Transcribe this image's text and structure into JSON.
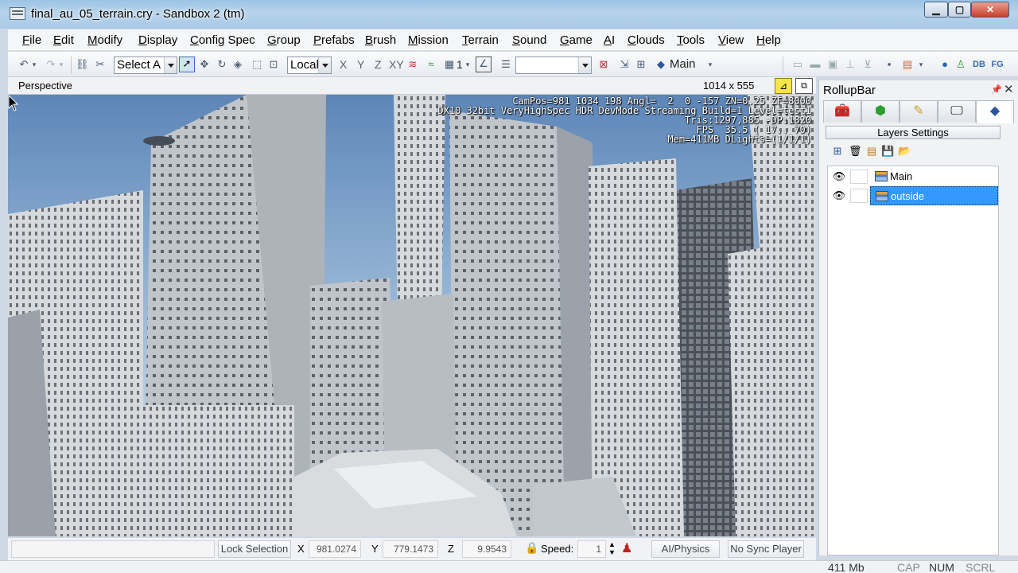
{
  "window": {
    "title": "final_au_05_terrain.cry - Sandbox 2 (tm)",
    "min_icon": "minimize-icon",
    "max_icon": "maximize-icon",
    "close_label": "✕"
  },
  "menu": [
    "File",
    "Edit",
    "Modify",
    "Display",
    "Config Spec",
    "Group",
    "Prefabs",
    "Brush",
    "Mission",
    "Terrain",
    "Sound",
    "Game",
    "AI",
    "Clouds",
    "Tools",
    "View",
    "Help"
  ],
  "toolbar": {
    "select_filter": "Select A",
    "coord_system": "Local",
    "axis_x": "X",
    "axis_y": "Y",
    "axis_z": "Z",
    "axis_xy": "XY",
    "grid_label": "1",
    "layer_label": "Main"
  },
  "viewport": {
    "title": "Perspective",
    "size": "1014 x 555",
    "hud_lines": [
      "CamPos=981 1034 198 Angl=  2  0 -157 ZN=0.25 ZF=8000",
      "DX10 32bit VeryHighSpec HDR DevMode Streaming Build=1 Level=test1",
      "Tris:1297,885 -DP:1820",
      "FPS  35.5 ( 17.. 70)",
      "Mem=411MB DLights=(1/1/1)"
    ]
  },
  "rollup": {
    "title": "RollupBar",
    "tabs": [
      "objects-tab-icon",
      "terrain-tab-icon",
      "modify-tab-icon",
      "display-tab-icon",
      "layers-tab-icon"
    ],
    "section_header": "Layers Settings",
    "layers": [
      {
        "name": "Main",
        "selected": false
      },
      {
        "name": "outside",
        "selected": true
      }
    ]
  },
  "infobar": {
    "lock_selection": "Lock Selection",
    "x_label": "X",
    "x_value": "981.0274",
    "y_label": "Y",
    "y_value": "779.1473",
    "z_label": "Z",
    "z_value": "9.9543",
    "speed_label": "Speed:",
    "speed_value": "1",
    "ai_physics": "AI/Physics",
    "sync_player": "No Sync Player"
  },
  "statusbar": {
    "memory": "411 Mb",
    "cap": "CAP",
    "num": "NUM",
    "scrl": "SCRL"
  },
  "colors": {
    "selection": "#3399ff",
    "sky": "#8fb0d2",
    "building": "#c8cdd2"
  }
}
